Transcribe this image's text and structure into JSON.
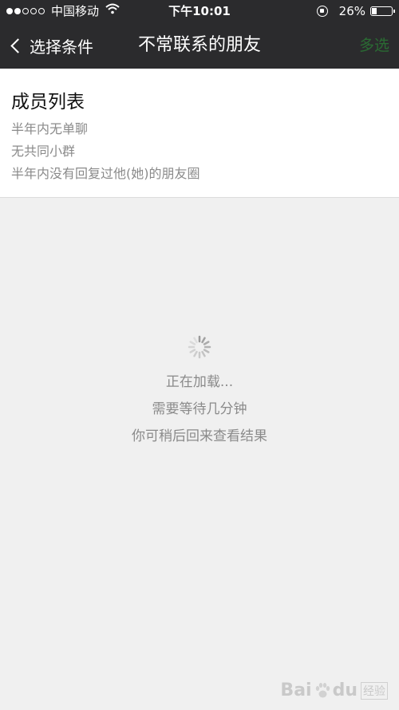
{
  "status_bar": {
    "carrier": "中国移动",
    "time": "下午10:01",
    "battery_text": "26%",
    "battery_level": 0.26
  },
  "nav": {
    "back_label": "选择条件",
    "title": "不常联系的朋友",
    "multi_select_label": "多选"
  },
  "criteria": {
    "heading": "成员列表",
    "items": [
      "半年内无单聊",
      "无共同小群",
      "半年内没有回复过他(她)的朋友圈"
    ]
  },
  "loading": {
    "lines": [
      "正在加载...",
      "需要等待几分钟",
      "你可稍后回来查看结果"
    ]
  },
  "watermark": {
    "text": "Bai",
    "text2": "du",
    "sub": "经验"
  },
  "colors": {
    "header_bg": "#2b2b2d",
    "accent_green": "#2a6b33",
    "muted_text": "#8a8a8a"
  }
}
